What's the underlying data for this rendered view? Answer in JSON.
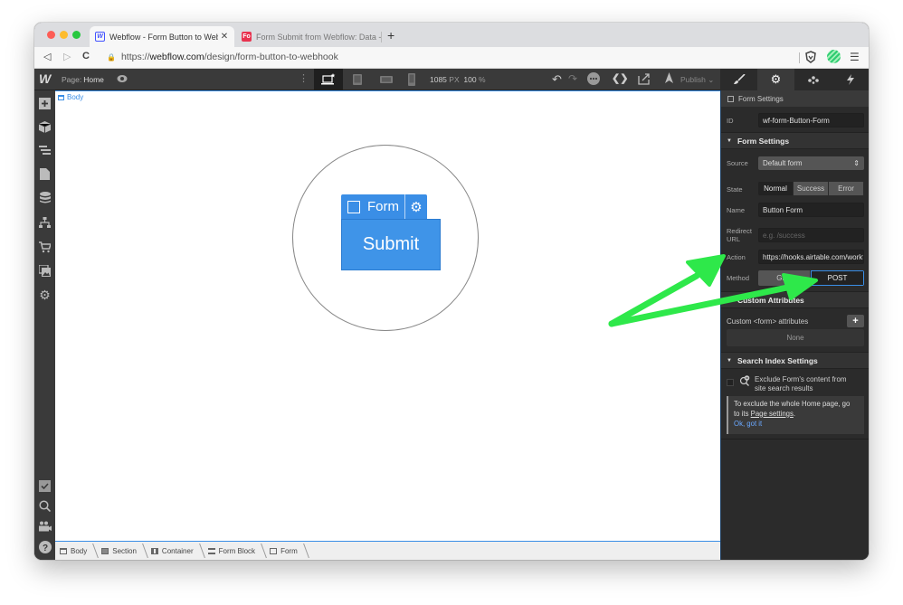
{
  "browser": {
    "tabs": [
      {
        "title": "Webflow - Form Button to Webflow",
        "favicon": "W",
        "active": true
      },
      {
        "title": "Form Submit from Webflow: Data -",
        "favicon": "Fo",
        "active": false
      }
    ],
    "close_glyph": "✕",
    "new_tab_glyph": "+",
    "url_scheme": "https://",
    "url_host": "webflow.com",
    "url_path": "/design/form-button-to-webhook",
    "nav": {
      "back": "◁",
      "forward": "▷",
      "reload": "C"
    },
    "menu_glyph": "☰"
  },
  "designer": {
    "logo": "W",
    "page_prefix": "Page:",
    "page_name": "Home",
    "viewport_width": "1085",
    "viewport_unit": "PX",
    "zoom": "100",
    "zoom_unit": "%",
    "publish_label": "Publish",
    "undo": "↶",
    "redo": "↷",
    "code": "❮❯",
    "panel_tabs": [
      {
        "name": "style-brush",
        "glyph": "🖌",
        "active": false
      },
      {
        "name": "settings-gear",
        "glyph": "⚙",
        "active": true
      },
      {
        "name": "interactions-drops",
        "glyph": "∴",
        "active": false
      },
      {
        "name": "lightning",
        "glyph": "⚡",
        "active": false
      }
    ]
  },
  "canvas": {
    "body_label": "Body",
    "form_tag_label": "Form",
    "form_gear_glyph": "⚙",
    "submit_label": "Submit"
  },
  "breadcrumb": [
    "Body",
    "Section",
    "Container",
    "Form Block",
    "Form"
  ],
  "panel": {
    "selected_element": "Form Settings",
    "id_label": "ID",
    "id_value": "wf-form-Button-Form",
    "form_settings_title": "Form Settings",
    "source_label": "Source",
    "source_value": "Default form",
    "state_label": "State",
    "states": [
      {
        "label": "Normal",
        "active": true
      },
      {
        "label": "Success",
        "active": false
      },
      {
        "label": "Error",
        "active": false
      }
    ],
    "name_label": "Name",
    "name_value": "Button Form",
    "redirect_label_1": "Redirect",
    "redirect_label_2": "URL",
    "redirect_placeholder": "e.g. /success",
    "action_label": "Action",
    "action_value": "https://hooks.airtable.com/workflows",
    "method_label": "Method",
    "methods": [
      {
        "label": "GET",
        "active": false
      },
      {
        "label": "POST",
        "active": true
      }
    ],
    "custom_attributes_title": "Custom Attributes",
    "custom_attrs_label": "Custom <form> attributes",
    "add_glyph": "+",
    "custom_attrs_empty": "None",
    "search_index_title": "Search Index Settings",
    "exclude_text_1": "Exclude Form's content from",
    "exclude_text_2": "site search results",
    "note_text_1": "To exclude the whole Home page, go",
    "note_text_2": "to its ",
    "note_link": "Page settings",
    "note_text_3": ".",
    "note_ok": "Ok, got it"
  },
  "annotation": {
    "arrow_color": "#2ee84a",
    "arrow_targets": [
      "Action",
      "POST"
    ]
  }
}
